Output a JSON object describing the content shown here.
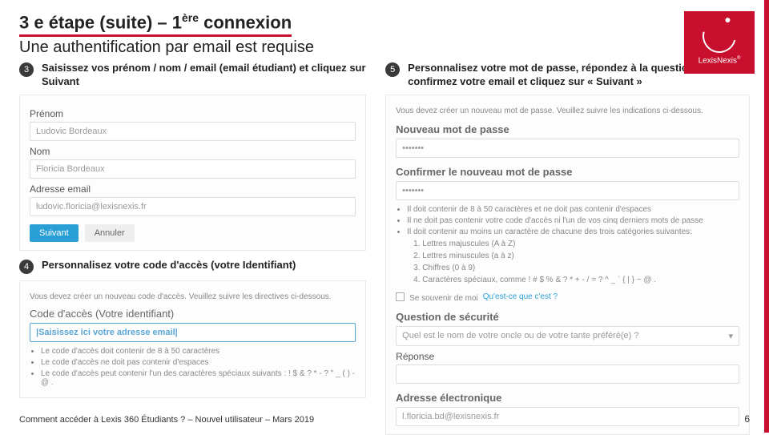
{
  "header": {
    "title_prefix": "3 e étape (suite) – 1",
    "title_super": "ère",
    "title_suffix": " connexion",
    "subtitle": "Une authentification par email est requise"
  },
  "logo": {
    "label": "LexisNexis",
    "reg": "®"
  },
  "steps": {
    "s3": {
      "num": "3",
      "text": "Saisissez vos prénom / nom / email (email étudiant) et cliquez sur Suivant"
    },
    "s4": {
      "num": "4",
      "text": "Personnalisez votre code d'accès (votre Identifiant)"
    },
    "s5": {
      "num": "5",
      "text": "Personnalisez votre mot de passe, répondez à la question secrète, confirmez votre email et cliquez sur « Suivant »"
    }
  },
  "form3": {
    "lbl_prenom": "Prénom",
    "val_prenom": "Ludovic Bordeaux",
    "lbl_nom": "Nom",
    "val_nom": "Floricia Bordeaux",
    "lbl_email": "Adresse email",
    "val_email": "ludovic.floricia@lexisnexis.fr",
    "btn_next": "Suivant",
    "btn_cancel": "Annuler"
  },
  "form4": {
    "intro": "Vous devez créer un nouveau code d'accès. Veuillez suivre les directives ci-dessous.",
    "heading": "Code d'accès (Votre identifiant)",
    "placeholder": "|Saisissez ici votre adresse email|",
    "b1": "Le code d'accès doit contenir de 8 à 50 caractères",
    "b2": "Le code d'accès ne doit pas contenir d'espaces",
    "b3": "Le code d'accès peut contenir l'un des caractères spéciaux suivants : ! $ & ? * - ? \" _   ( ) -  @ ."
  },
  "form5": {
    "intro": "Vous devez créer un nouveau mot de passe. Veuillez suivre les indications ci-dessous.",
    "lbl_new": "Nouveau mot de passe",
    "val_pwd": "•••••••",
    "lbl_confirm": "Confirmer le nouveau mot de passe",
    "b_len": "Il doit contenir de 8 à 50 caractères et ne doit pas contenir d'espaces",
    "b_hist": "Il ne doit pas contenir votre code d'accès ni l'un de vos cinq derniers mots de passe",
    "b_cat": "Il doit contenir au moins un caractère de chacune des trois catégories suivantes:",
    "c1": "1. Lettres majuscules (A à Z)",
    "c2": "2. Lettres minuscules (a à z)",
    "c3": "3. Chiffres (0 à 9)",
    "c4": "4. Caractères spéciaux, comme ! # $ % & ? * + - / = ? ^ _  ` { | } ~ @ .",
    "remember": "Se souvenir de moi",
    "what": "Qu'est-ce que c'est ?",
    "sec_q_heading": "Question de sécurité",
    "sec_q": "Quel est le nom de votre oncle ou de votre tante préféré(e) ?",
    "lbl_answer": "Réponse",
    "lbl_email2": "Adresse électronique",
    "val_email2": "l.floricia.bd@lexisnexis.fr"
  },
  "footer": "Comment accéder à Lexis 360 Étudiants ? – Nouvel utilisateur – Mars 2019",
  "page": "6"
}
